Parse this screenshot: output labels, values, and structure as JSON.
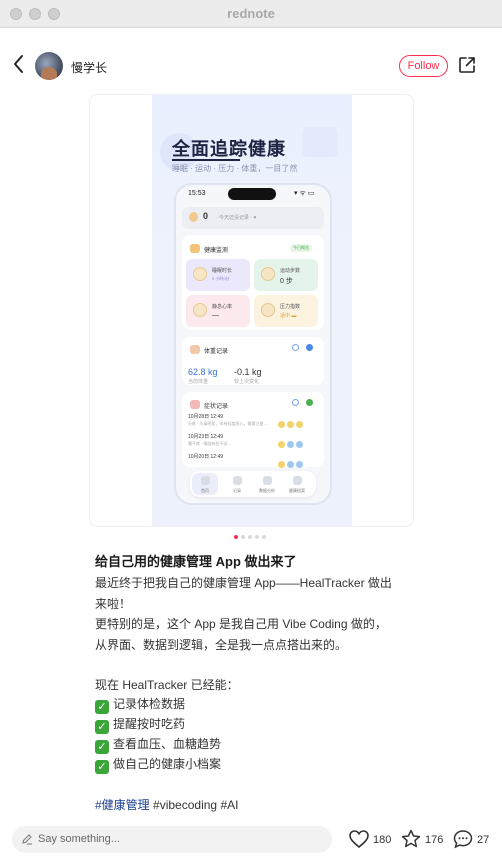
{
  "window": {
    "title": "rednote"
  },
  "header": {
    "username": "慢学长",
    "follow_label": "Follow"
  },
  "image": {
    "hero_title": "全面追踪健康",
    "hero_subtitle": "睡眠 · 运动 · 压力 · 体重，一目了然",
    "phone": {
      "time": "15:53",
      "status": "▾ ᯤ ▭",
      "score_value": "0",
      "score_text": "· 今天还没记录 · ♥",
      "health_title": "健康监测",
      "health_badge": "今日概览",
      "tiles": [
        {
          "label": "睡眠时长",
          "value": "0 小时0分"
        },
        {
          "label": "运动步数",
          "value": "0 步"
        },
        {
          "label": "静息心率",
          "value": "—"
        },
        {
          "label": "压力指数",
          "value": "适中 ▬"
        }
      ],
      "weight_title": "体重记录",
      "weight_value": "62.8 kg",
      "weight_delta": "-0.1 kg",
      "weight_sub1": "当前体重",
      "weight_sub2": "较上次变化",
      "symptom_title": "症状记录",
      "records": [
        {
          "date": "10月28日 12:49",
          "note": "头疼 · 头痛明显，伴有轻度恶心，需要注意…"
        },
        {
          "date": "10月23日 12:49",
          "note": "嗓子疼 · 喉咙有些不适…"
        },
        {
          "date": "10月20日 12:49",
          "note": ""
        }
      ],
      "tabs": [
        "首页",
        "记录",
        "数据分析",
        "健康档案"
      ]
    }
  },
  "post": {
    "title": "给自己用的健康管理 App 做出来了",
    "lines": [
      "最近终于把我自己的健康管理 App——HealTracker 做出",
      "来啦！",
      "更特别的是，这个 App 是我自己用 Vibe Coding 做的，",
      "从界面、数据到逻辑，全是我一点点搭出来的。",
      "现在 HealTracker 已经能："
    ],
    "checklist": [
      "记录体检数据",
      "提醒按时吃药",
      "查看血压、血糖趋势",
      "做自己的健康小档案"
    ],
    "tags": [
      "#健康管理",
      "#vibecoding",
      "#AI"
    ]
  },
  "bottom": {
    "comment_placeholder": "Say something...",
    "likes": "180",
    "favorites": "176",
    "comments": "27"
  },
  "colors": {
    "brand": "#ff2e4d",
    "tag": "#1c3f8e",
    "check": "#3aa63a"
  }
}
